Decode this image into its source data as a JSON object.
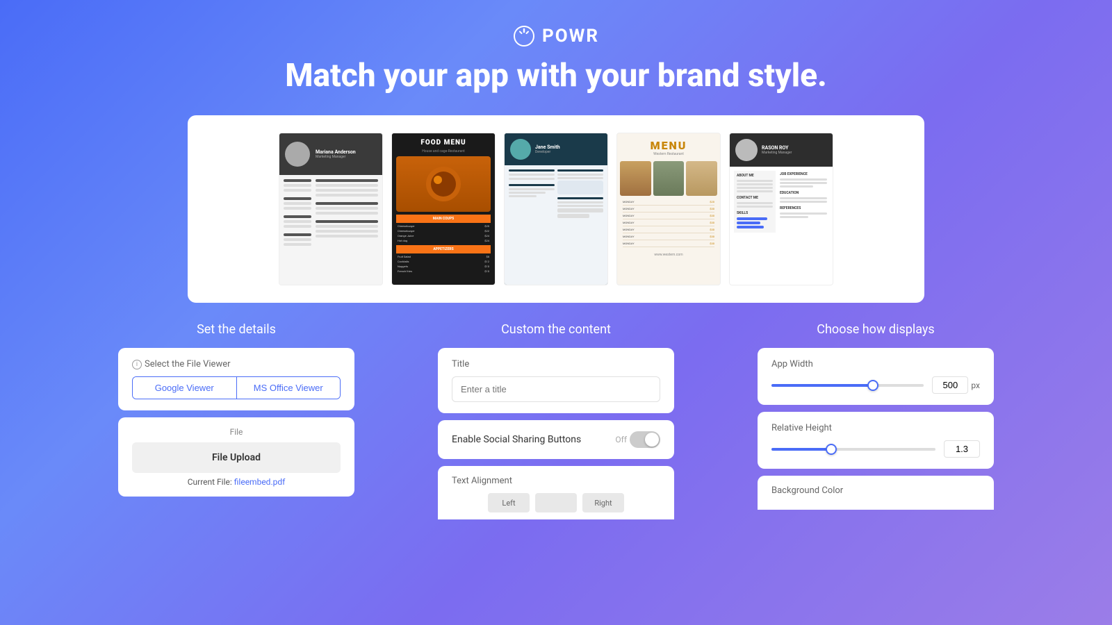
{
  "logo": {
    "text": "POWR",
    "icon": "⏻"
  },
  "hero": {
    "title": "Match your app with your brand style."
  },
  "columns": {
    "left": {
      "title": "Set the details",
      "file_viewer": {
        "label": "Select the File Viewer",
        "options": [
          "Google Viewer",
          "MS Office Viewer"
        ],
        "active": 0
      },
      "file": {
        "label": "File",
        "upload_label": "File Upload",
        "current_file_prefix": "Current File: ",
        "current_file_name": "fileembed.pdf"
      }
    },
    "center": {
      "title": "Custom the content",
      "title_field": {
        "label": "Title",
        "placeholder": "Enter a title"
      },
      "social_sharing": {
        "label": "Enable Social Sharing Buttons",
        "state": "Off"
      },
      "text_alignment": {
        "label": "Text Alignment"
      }
    },
    "right": {
      "title": "Choose how displays",
      "app_width": {
        "label": "App Width",
        "value": "500",
        "unit": "px",
        "slider_percent": 65
      },
      "relative_height": {
        "label": "Relative Height",
        "value": "1.3",
        "slider_percent": 35
      },
      "background_color": {
        "label": "Background Color"
      }
    }
  }
}
